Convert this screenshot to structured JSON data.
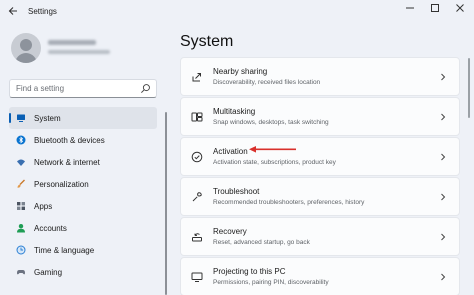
{
  "window": {
    "title": "Settings",
    "back_icon": "back-arrow-icon",
    "controls": [
      "minimize",
      "maximize",
      "close"
    ]
  },
  "sidebar": {
    "search": {
      "placeholder": "Find a setting"
    },
    "items": [
      {
        "label": "System",
        "icon": "system-icon",
        "icon_color": "#0a5fb4",
        "active": true
      },
      {
        "label": "Bluetooth & devices",
        "icon": "bluetooth-icon",
        "icon_color": "#0a74d0",
        "active": false
      },
      {
        "label": "Network & internet",
        "icon": "wifi-icon",
        "icon_color": "#3a6fb0",
        "active": false
      },
      {
        "label": "Personalization",
        "icon": "brush-icon",
        "icon_color": "#c97a2d",
        "active": false
      },
      {
        "label": "Apps",
        "icon": "apps-icon",
        "icon_color": "#4c5562",
        "active": false
      },
      {
        "label": "Accounts",
        "icon": "accounts-icon",
        "icon_color": "#1f9d55",
        "active": false
      },
      {
        "label": "Time & language",
        "icon": "globe-clock-icon",
        "icon_color": "#2a7fd4",
        "active": false
      },
      {
        "label": "Gaming",
        "icon": "gaming-icon",
        "icon_color": "#6b7280",
        "active": false
      }
    ]
  },
  "main": {
    "title": "System",
    "cards": [
      {
        "title": "Nearby sharing",
        "subtitle": "Discoverability, received files location",
        "icon": "share-icon"
      },
      {
        "title": "Multitasking",
        "subtitle": "Snap windows, desktops, task switching",
        "icon": "multitasking-icon"
      },
      {
        "title": "Activation",
        "subtitle": "Activation state, subscriptions, product key",
        "icon": "activation-check-icon"
      },
      {
        "title": "Troubleshoot",
        "subtitle": "Recommended troubleshooters, preferences, history",
        "icon": "wrench-icon"
      },
      {
        "title": "Recovery",
        "subtitle": "Reset, advanced startup, go back",
        "icon": "recovery-icon"
      },
      {
        "title": "Projecting to this PC",
        "subtitle": "Permissions, pairing PIN, discoverability",
        "icon": "projecting-icon"
      }
    ]
  },
  "colors": {
    "accent": "#0a5fb4",
    "annotation_arrow": "#d9302c"
  }
}
